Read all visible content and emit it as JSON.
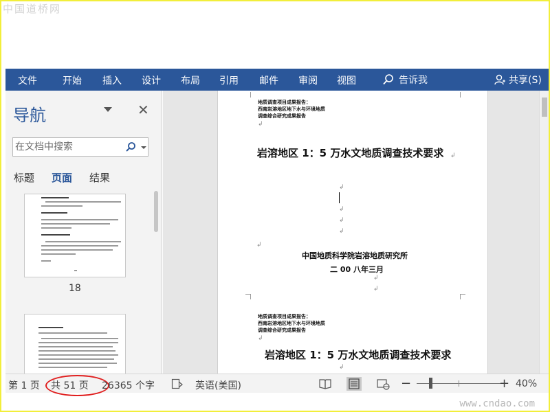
{
  "watermarks": {
    "top": "中国道桥网",
    "bottom": "www.cndao.com"
  },
  "ribbon": {
    "tabs": [
      "文件",
      "开始",
      "插入",
      "设计",
      "布局",
      "引用",
      "邮件",
      "审阅",
      "视图"
    ],
    "tell_me": "告诉我",
    "share": "共享(S)",
    "background": "#2b579a"
  },
  "nav": {
    "title": "导航",
    "close": "✕",
    "search_placeholder": "在文档中搜索",
    "tabs": [
      "标题",
      "页面",
      "结果"
    ],
    "active_tab": "页面",
    "thumbnails": [
      {
        "label": "18"
      },
      {
        "label": ""
      }
    ]
  },
  "document": {
    "header_lines_1": [
      "地质调查项目成果报告：",
      "西南岩溶地区地下水与环境地质",
      "调查综合研究成果报告"
    ],
    "title_1": "岩溶地区 1：5 万水文地质调查技术要求",
    "org": "中国地质科学院岩溶地质研究所",
    "date": "二 00 八年三月",
    "header_lines_2": [
      "地质调查项目成果报告：",
      "西南岩溶地区地下水与环境地质",
      "调查综合研究成果报告"
    ],
    "title_2": "岩溶地区 1：5 万水文地质调查技术要求",
    "paragraph_mark": "↲"
  },
  "status": {
    "page": "第 1 页",
    "total_pages": "共 51 页",
    "word_count": "26365 个字",
    "language": "英语(美国)",
    "zoom_minus": "−",
    "zoom_plus": "+",
    "zoom": "40%",
    "zoom_value": 40
  }
}
